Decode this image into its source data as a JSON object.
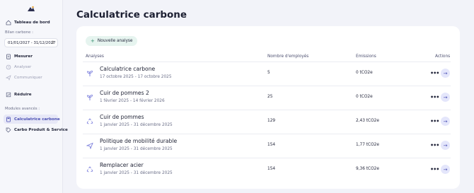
{
  "sidebar": {
    "items": [
      {
        "label": "Tableau de bord",
        "icon": "home-icon"
      },
      {
        "label": "Mesurer",
        "icon": "clipboard-icon"
      },
      {
        "label": "Analyser",
        "icon": "clock-icon"
      },
      {
        "label": "Communiquer",
        "icon": "send-icon"
      },
      {
        "label": "Réduire",
        "icon": "chart-icon"
      },
      {
        "label": "Calculatrice carbone",
        "icon": "calculator-icon"
      },
      {
        "label": "Carbo Produit & Service",
        "icon": "tag-icon"
      }
    ],
    "bilan_label": "Bilan carbone :",
    "bilan_value": "01/01/2027 - 31/12/2027",
    "modules_label": "Modules avancés :"
  },
  "main": {
    "title": "Calculatrice carbone",
    "new_button": "Nouvelle analyse",
    "columns": {
      "analyses": "Analyses",
      "employees": "Nombre d'employés",
      "emissions": "Emissions",
      "actions": "Actions"
    },
    "rows": [
      {
        "name": "Calculatrice carbone",
        "dates": "17 octobre 2025 - 17 octobre 2025",
        "employees": "5",
        "emissions": "0 tCO2e",
        "icon": "sprout-icon"
      },
      {
        "name": "Cuir de pommes 2",
        "dates": "1 février 2025 - 14 février 2026",
        "employees": "25",
        "emissions": "0 tCO2e",
        "icon": "sprout-icon"
      },
      {
        "name": "Cuir de pommes",
        "dates": "1 janvier 2025 - 31 décembre 2025",
        "employees": "129",
        "emissions": "2,43 tCO2e",
        "icon": "recycle-icon"
      },
      {
        "name": "Politique de mobilité durable",
        "dates": "1 janvier 2025 - 31 décembre 2025",
        "employees": "154",
        "emissions": "1,77 tCO2e",
        "icon": "plane-icon"
      },
      {
        "name": "Remplacer acier",
        "dates": "1 janvier 2025 - 31 décembre 2025",
        "employees": "154",
        "emissions": "9,36 tCO2e",
        "icon": "recycle-icon"
      }
    ],
    "row_menu": "•••",
    "row_arrow": "→"
  }
}
